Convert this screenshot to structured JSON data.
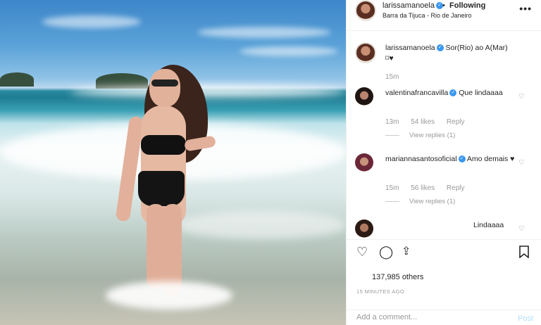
{
  "post": {
    "username": "larissamanoela",
    "follow_status": "Following",
    "dot": "•",
    "location": "Barra da Tijuca - Rio de Janeiro",
    "more": "•••"
  },
  "caption": {
    "username": "larissamanoela",
    "text": "Sor(Rio) ao A(Mar) ⌑♥",
    "age": "15m"
  },
  "comments": [
    {
      "username": "valentinafrancavilla",
      "text": "Que lindaaaa",
      "age": "13m",
      "likes": "54 likes",
      "reply": "Reply",
      "view_replies": "View replies (1)"
    },
    {
      "username": "mariannasantosoficial",
      "text": "Amo demais ♥",
      "age": "15m",
      "likes": "56 likes",
      "reply": "Reply",
      "view_replies": "View replies (1)"
    },
    {
      "username": "",
      "text": "Lindaaaa"
    }
  ],
  "likes_text": "137,985 others",
  "timestamp": "15 MINUTES AGO",
  "add_comment": {
    "placeholder": "Add a comment...",
    "post_label": "Post"
  },
  "icons": {
    "like": "heart-icon",
    "comment": "comment-icon",
    "share": "share-icon",
    "save": "bookmark-icon"
  },
  "colors": {
    "verified": "#3897f0",
    "post_disabled": "#b2dffc"
  }
}
